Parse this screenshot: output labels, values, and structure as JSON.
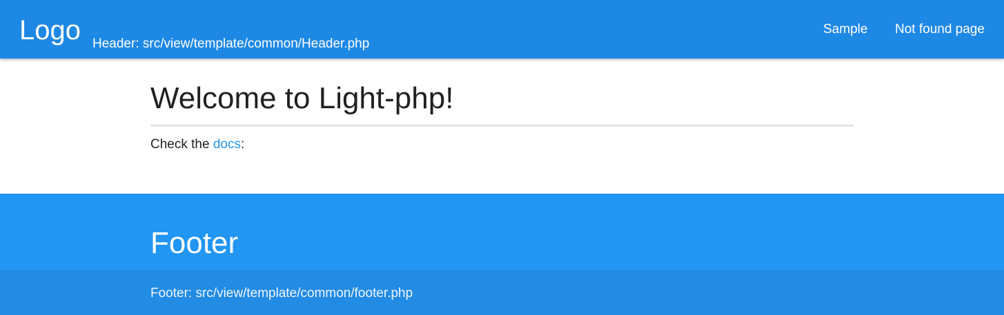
{
  "header": {
    "logo": "Logo",
    "note": "Header: src/view/template/common/Header.php",
    "nav": [
      {
        "label": "Sample"
      },
      {
        "label": "Not found page"
      }
    ]
  },
  "main": {
    "title": "Welcome to Light-php!",
    "intro_prefix": "Check the ",
    "intro_link": "docs",
    "intro_suffix": ":"
  },
  "footer": {
    "title": "Footer",
    "note": "Footer: src/view/template/common/footer.php"
  },
  "colors": {
    "header_bg": "#1e88e5",
    "footer_bg": "#2196f3",
    "footer_bottom_bg": "#228be3",
    "link": "#2196f3",
    "text": "#212121"
  }
}
